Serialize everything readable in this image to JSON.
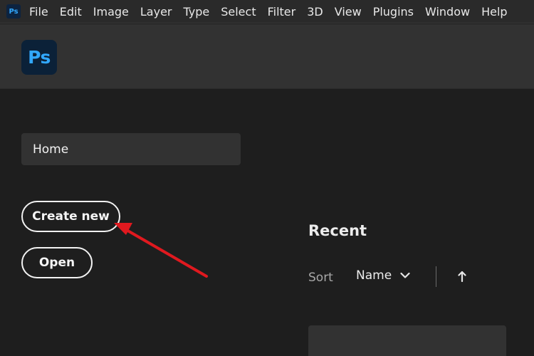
{
  "menubar": {
    "logo_text": "Ps",
    "items": [
      "File",
      "Edit",
      "Image",
      "Layer",
      "Type",
      "Select",
      "Filter",
      "3D",
      "View",
      "Plugins",
      "Window",
      "Help"
    ]
  },
  "header": {
    "logo_text": "Ps"
  },
  "sidebar": {
    "home_label": "Home",
    "create_new_label": "Create new",
    "open_label": "Open"
  },
  "recent": {
    "title": "Recent",
    "sort_label": "Sort",
    "sort_value": "Name",
    "sort_direction_icon": "arrow-up-icon"
  },
  "annotation": {
    "color": "#e0191f",
    "target": "create-new-button"
  },
  "colors": {
    "ps_blue": "#31a8ff",
    "ps_dark": "#0b2138",
    "panel": "#323232",
    "background": "#1e1e1e"
  }
}
